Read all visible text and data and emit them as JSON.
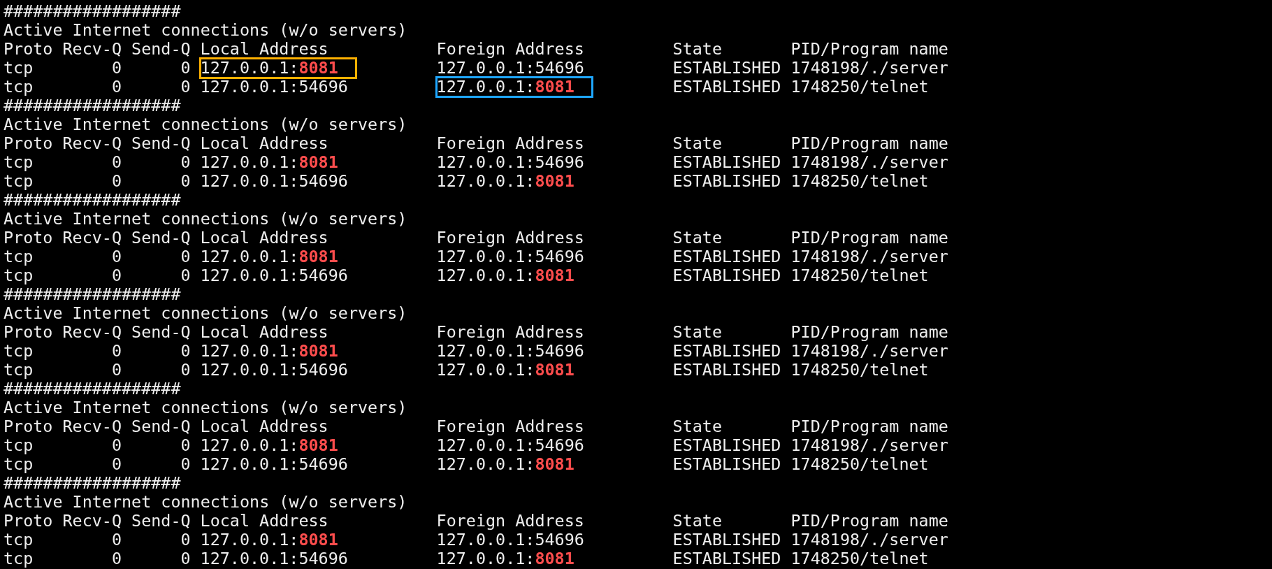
{
  "blocks": [
    {
      "separator": "##################",
      "title": "Active Internet connections (w/o servers)",
      "header": [
        "Proto",
        "Recv-Q",
        "Send-Q",
        "Local Address",
        "Foreign Address",
        "State",
        "PID/Program name"
      ],
      "rows": [
        {
          "proto": "tcp",
          "recv_q": "0",
          "send_q": "0",
          "local_address": {
            "text": "127.0.0.1:**8081**",
            "color": "#ffb000"
          },
          "foreign_address": {
            "text": "127.0.0.1:54696"
          },
          "state": "ESTABLISHED",
          "program": "1748198/./server"
        },
        {
          "proto": "tcp",
          "recv_q": "0",
          "send_q": "0",
          "local_address": {
            "text": "127.0.0.1:54696"
          },
          "foreign_address": {
            "text": "127.0.0.1:**8081**",
            "color": "#1ea7ff"
          },
          "state": "ESTABLISHED",
          "program": "1748250/telnet"
        }
      ]
    },
    {
      "separator": "##################",
      "title": "Active Internet connections (w/o servers)",
      "header": [
        "Proto",
        "Recv-Q",
        "Send-Q",
        "Local Address",
        "Foreign Address",
        "State",
        "PID/Program name"
      ],
      "rows": [
        {
          "proto": "tcp",
          "recv_q": "0",
          "send_q": "0",
          "local_address": {
            "text": "127.0.0.1:**8081**"
          },
          "foreign_address": {
            "text": "127.0.0.1:54696"
          },
          "state": "ESTABLISHED",
          "program": "1748198/./server"
        },
        {
          "proto": "tcp",
          "recv_q": "0",
          "send_q": "0",
          "local_address": {
            "text": "127.0.0.1:54696"
          },
          "foreign_address": {
            "text": "127.0.0.1:**8081**"
          },
          "state": "ESTABLISHED",
          "program": "1748250/telnet"
        }
      ]
    },
    {
      "separator": "##################",
      "title": "Active Internet connections (w/o servers)",
      "header": [
        "Proto",
        "Recv-Q",
        "Send-Q",
        "Local Address",
        "Foreign Address",
        "State",
        "PID/Program name"
      ],
      "rows": [
        {
          "proto": "tcp",
          "recv_q": "0",
          "send_q": "0",
          "local_address": {
            "text": "127.0.0.1:**8081**"
          },
          "foreign_address": {
            "text": "127.0.0.1:54696"
          },
          "state": "ESTABLISHED",
          "program": "1748198/./server"
        },
        {
          "proto": "tcp",
          "recv_q": "0",
          "send_q": "0",
          "local_address": {
            "text": "127.0.0.1:54696"
          },
          "foreign_address": {
            "text": "127.0.0.1:**8081**"
          },
          "state": "ESTABLISHED",
          "program": "1748250/telnet"
        }
      ]
    },
    {
      "separator": "##################",
      "title": "Active Internet connections (w/o servers)",
      "header": [
        "Proto",
        "Recv-Q",
        "Send-Q",
        "Local Address",
        "Foreign Address",
        "State",
        "PID/Program name"
      ],
      "rows": [
        {
          "proto": "tcp",
          "recv_q": "0",
          "send_q": "0",
          "local_address": {
            "text": "127.0.0.1:**8081**"
          },
          "foreign_address": {
            "text": "127.0.0.1:54696"
          },
          "state": "ESTABLISHED",
          "program": "1748198/./server"
        },
        {
          "proto": "tcp",
          "recv_q": "0",
          "send_q": "0",
          "local_address": {
            "text": "127.0.0.1:54696"
          },
          "foreign_address": {
            "text": "127.0.0.1:**8081**"
          },
          "state": "ESTABLISHED",
          "program": "1748250/telnet"
        }
      ]
    },
    {
      "separator": "##################",
      "title": "Active Internet connections (w/o servers)",
      "header": [
        "Proto",
        "Recv-Q",
        "Send-Q",
        "Local Address",
        "Foreign Address",
        "State",
        "PID/Program name"
      ],
      "rows": [
        {
          "proto": "tcp",
          "recv_q": "0",
          "send_q": "0",
          "local_address": {
            "text": "127.0.0.1:**8081**"
          },
          "foreign_address": {
            "text": "127.0.0.1:54696"
          },
          "state": "ESTABLISHED",
          "program": "1748198/./server"
        },
        {
          "proto": "tcp",
          "recv_q": "0",
          "send_q": "0",
          "local_address": {
            "text": "127.0.0.1:54696"
          },
          "foreign_address": {
            "text": "127.0.0.1:**8081**"
          },
          "state": "ESTABLISHED",
          "program": "1748250/telnet"
        }
      ]
    },
    {
      "separator": "##################",
      "title": "Active Internet connections (w/o servers)",
      "header": [
        "Proto",
        "Recv-Q",
        "Send-Q",
        "Local Address",
        "Foreign Address",
        "State",
        "PID/Program name"
      ],
      "rows": [
        {
          "proto": "tcp",
          "recv_q": "0",
          "send_q": "0",
          "local_address": {
            "text": "127.0.0.1:**8081**"
          },
          "foreign_address": {
            "text": "127.0.0.1:54696"
          },
          "state": "ESTABLISHED",
          "program": "1748198/./server"
        },
        {
          "proto": "tcp",
          "recv_q": "0",
          "send_q": "0",
          "local_address": {
            "text": "127.0.0.1:54696"
          },
          "foreign_address": {
            "text": "127.0.0.1:**8081**"
          },
          "state": "ESTABLISHED",
          "program": "1748250/telnet"
        }
      ]
    }
  ]
}
